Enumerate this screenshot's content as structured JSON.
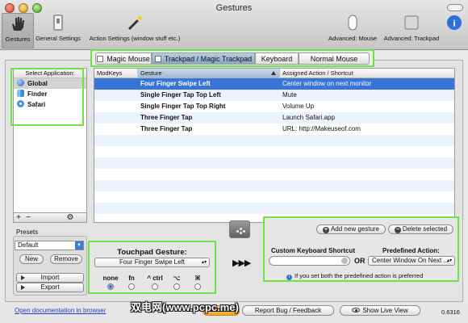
{
  "window": {
    "title": "Gestures"
  },
  "toolbar": {
    "gestures": "Gestures",
    "general_settings": "General Settings",
    "action_settings": "Action Settings (window stuff etc.)",
    "advanced_mouse": "Advanced: Mouse",
    "advanced_trackpad": "Advanced: Trackpad"
  },
  "tabs": [
    {
      "label": "Magic Mouse",
      "selected": false
    },
    {
      "label": "Trackpad / Magic Trackpad",
      "selected": true
    },
    {
      "label": "Keyboard",
      "selected": false
    },
    {
      "label": "Normal Mouse",
      "selected": false
    }
  ],
  "apps": {
    "header": "Select Application:",
    "items": [
      {
        "name": "Global",
        "icon": "globe-icon",
        "selected": true
      },
      {
        "name": "Finder",
        "icon": "finder-icon",
        "selected": false
      },
      {
        "name": "Safari",
        "icon": "compass-icon",
        "selected": false
      }
    ],
    "footer": {
      "add": "+",
      "remove": "−",
      "gear": "⚙"
    }
  },
  "table": {
    "headers": [
      "ModKeys",
      "Gesture",
      "Assigned Action / Shortcut"
    ],
    "rows": [
      {
        "modkeys": "",
        "gesture": "Four Finger Swipe Left",
        "action": "Center window on next monitor",
        "selected": true
      },
      {
        "modkeys": "",
        "gesture": "Single Finger Tap Top Left",
        "action": "Mute",
        "selected": false
      },
      {
        "modkeys": "",
        "gesture": "Single Finger Tap Top Right",
        "action": "Volume Up",
        "selected": false
      },
      {
        "modkeys": "",
        "gesture": "Three Finger Tap",
        "action": "Launch Safari.app",
        "selected": false
      },
      {
        "modkeys": "",
        "gesture": "Three Finger Tap",
        "action": "URL: http://Makeuseof.com",
        "selected": false
      }
    ]
  },
  "presets": {
    "title": "Presets",
    "selected": "Default",
    "new": "New",
    "remove": "Remove",
    "import": "Import",
    "export": "Export"
  },
  "touchpad": {
    "title": "Touchpad Gesture:",
    "selected_gesture": "Four Finger Swipe Left",
    "modifiers": [
      {
        "label": "none",
        "checked": true
      },
      {
        "label": "fn",
        "checked": false
      },
      {
        "label": "^ ctrl",
        "checked": false
      },
      {
        "label": "⌥",
        "checked": false
      },
      {
        "label": "⌘",
        "checked": false
      }
    ]
  },
  "middle": {
    "arrows": "▶▶▶"
  },
  "actions": {
    "add_gesture": "Add new gesture",
    "delete_selected": "Delete selected",
    "custom_shortcut_label": "Custom Keyboard Shortcut",
    "or_label": "OR",
    "predefined_label": "Predefined Action:",
    "predefined_value": "Center Window On Next ...",
    "info_note": "If you set both the predefined action is preferred"
  },
  "footer": {
    "doc_link": "Open documentation in browser",
    "donate": "Donate",
    "report_bug": "Report Bug / Feedback",
    "show_live_view": "Show Live View",
    "version": "0.6316"
  },
  "watermark": "双电网(www.pcpc.me)",
  "colors": {
    "highlight": "#6fe24a",
    "selection": "#3875d7"
  }
}
